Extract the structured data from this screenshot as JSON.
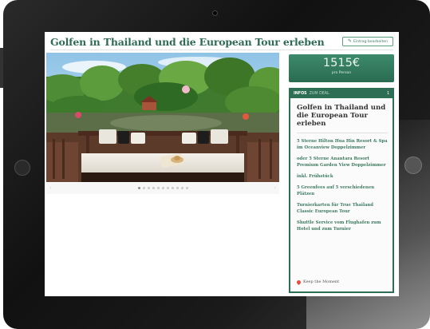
{
  "page": {
    "title": "Golfen in Thailand und die European Tour erleben",
    "edit_label": "Eintrag bearbeiten"
  },
  "pricing": {
    "price": "1515€",
    "per_person": "pro Person"
  },
  "info_panel": {
    "header_bold": "INFOS",
    "header_light": "ZUM DEAL",
    "header_count": "1",
    "title": "Golfen in Thailand und die European Tour erleben",
    "features": [
      "5 Sterne Hilton Hua Hin Resort & Spa im Oceanview Doppelzimmer",
      "oder 5 Sterne Anantara Resort Premium Garden View Doppelzimmer",
      "inkl. Frühstück",
      "5 Greenfees auf 5 verschiedenen Plätzen",
      "Turnierkarten für True Thailand Classic European Tour",
      "Shuttle Service vom Flughafen zum Hotel und zum Turnier"
    ],
    "footer": "Keep the Moment"
  },
  "gallery": {
    "dots": 11,
    "active_dot": 0
  },
  "colors": {
    "accent": "#2d6e55",
    "title_green": "#2f6b55",
    "feature_green": "#3d7a60"
  }
}
